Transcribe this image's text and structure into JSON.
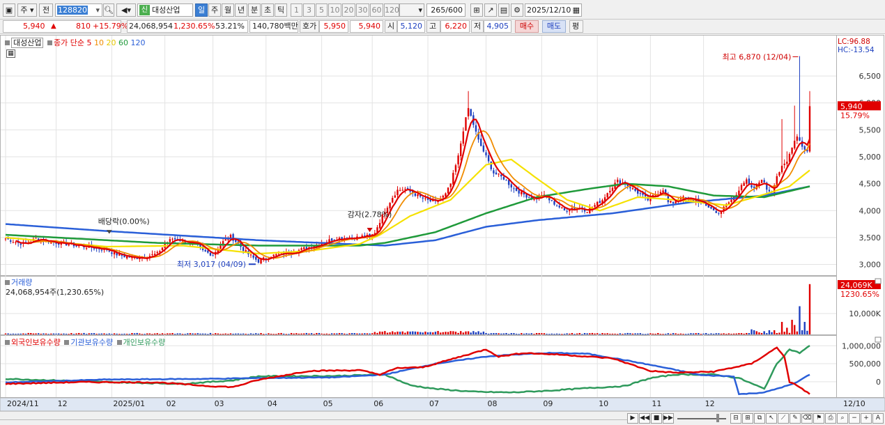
{
  "toolbar": {
    "market": "주",
    "prev": "전",
    "code": "128820",
    "periods": [
      "일",
      "주",
      "월",
      "년",
      "분",
      "초",
      "틱"
    ],
    "active_period": "일",
    "intervals": [
      "1",
      "3",
      "5",
      "10",
      "20",
      "30",
      "60",
      "120"
    ],
    "count": "265",
    "count_max": "/600",
    "date": "2025/12/10",
    "stock_badge": "신",
    "stock_name": "대성산업"
  },
  "info": {
    "price": "5,940",
    "change_arrow": "▲",
    "change": "810",
    "change_pct": "+15.79%",
    "volume": "24,068,954",
    "volume_ratio": "1,230.65%",
    "turnover": "53.21%",
    "amount": "140,780백만",
    "quote_label": "호가",
    "ask": "5,950",
    "bid": "5,940",
    "open_label": "시",
    "open": "5,120",
    "high_label": "고",
    "high": "6,220",
    "low_label": "저",
    "low": "4,905",
    "buy_label": "매수",
    "sell_label": "매도",
    "eval_label": "평"
  },
  "colors": {
    "up": "#e00000",
    "down": "#1d3fbf",
    "ma5": "#e00000",
    "ma10": "#f08c00",
    "ma20": "#f5e100",
    "ma60": "#1f9a3a",
    "ma120": "#2a5fd8",
    "foreign": "#e00000",
    "institution": "#2a5fd8",
    "individual": "#2f9a5c"
  },
  "chart_data": [
    {
      "type": "candlestick",
      "legend_name": "대성산업",
      "legend_items": [
        {
          "label": "종가 단순 5",
          "color": "#e00000"
        },
        {
          "label": "10",
          "color": "#f08c00"
        },
        {
          "label": "20",
          "color": "#e6c800"
        },
        {
          "label": "60",
          "color": "#1f9a3a"
        },
        {
          "label": "120",
          "color": "#2a5fd8"
        }
      ],
      "y_ticks": [
        "6,500",
        "6,000",
        "5,500",
        "5,000",
        "4,500",
        "4,000",
        "3,500",
        "3,000"
      ],
      "ylim": [
        2800,
        7200
      ],
      "lc_label": "LC:96.88",
      "hc_label": "HC:-13.54",
      "last_price_tag": "5,940",
      "last_pct_tag": "15.79%",
      "annotations": {
        "high": "최고 6,870 (12/04)",
        "low": "최저 3,017 (04/09)",
        "dividend": "배당락(0.00%)",
        "capital_reduction": "감자(2.78%)"
      },
      "anchors": [
        [
          0,
          3480
        ],
        [
          5,
          3400
        ],
        [
          8,
          3380
        ],
        [
          12,
          3480
        ],
        [
          18,
          3420
        ],
        [
          24,
          3380
        ],
        [
          30,
          3340
        ],
        [
          36,
          3300
        ],
        [
          40,
          3280
        ],
        [
          43,
          3200
        ],
        [
          47,
          3150
        ],
        [
          51,
          3120
        ],
        [
          55,
          3140
        ],
        [
          60,
          3200
        ],
        [
          63,
          3380
        ],
        [
          66,
          3480
        ],
        [
          69,
          3450
        ],
        [
          72,
          3400
        ],
        [
          75,
          3380
        ],
        [
          78,
          3250
        ],
        [
          82,
          3180
        ],
        [
          86,
          3420
        ],
        [
          89,
          3520
        ],
        [
          92,
          3380
        ],
        [
          95,
          3230
        ],
        [
          98,
          3120
        ],
        [
          100,
          3060
        ],
        [
          102,
          3100
        ],
        [
          105,
          3160
        ],
        [
          110,
          3200
        ],
        [
          115,
          3250
        ],
        [
          120,
          3320
        ],
        [
          125,
          3400
        ],
        [
          130,
          3480
        ],
        [
          135,
          3500
        ],
        [
          140,
          3500
        ],
        [
          142,
          3540
        ],
        [
          144,
          3500
        ],
        [
          146,
          3600
        ],
        [
          148,
          3800
        ],
        [
          150,
          4000
        ],
        [
          153,
          4250
        ],
        [
          155,
          4380
        ],
        [
          158,
          4400
        ],
        [
          162,
          4300
        ],
        [
          166,
          4200
        ],
        [
          170,
          4150
        ],
        [
          174,
          4300
        ],
        [
          176,
          4500
        ],
        [
          179,
          5000
        ],
        [
          181,
          5500
        ],
        [
          183,
          5900
        ],
        [
          185,
          5600
        ],
        [
          187,
          5300
        ],
        [
          190,
          5000
        ],
        [
          193,
          4700
        ],
        [
          197,
          4600
        ],
        [
          201,
          4400
        ],
        [
          205,
          4300
        ],
        [
          209,
          4200
        ],
        [
          212,
          4300
        ],
        [
          215,
          4200
        ],
        [
          218,
          4100
        ],
        [
          221,
          4000
        ],
        [
          224,
          4050
        ],
        [
          227,
          4050
        ],
        [
          230,
          4000
        ],
        [
          233,
          4100
        ],
        [
          236,
          4200
        ],
        [
          239,
          4400
        ],
        [
          242,
          4550
        ],
        [
          245,
          4500
        ],
        [
          248,
          4400
        ],
        [
          251,
          4300
        ],
        [
          254,
          4200
        ],
        [
          257,
          4300
        ],
        [
          260,
          4400
        ],
        [
          262,
          4150
        ],
        [
          264,
          4150
        ],
        [
          267,
          4250
        ],
        [
          270,
          4200
        ],
        [
          273,
          4200
        ],
        [
          276,
          4100
        ],
        [
          279,
          4050
        ],
        [
          281,
          3950
        ],
        [
          283,
          4000
        ],
        [
          285,
          4100
        ],
        [
          287,
          4200
        ],
        [
          289,
          4300
        ],
        [
          291,
          4500
        ],
        [
          293,
          4550
        ],
        [
          295,
          4400
        ],
        [
          297,
          4450
        ],
        [
          299,
          4600
        ],
        [
          301,
          4400
        ],
        [
          303,
          4350
        ],
        [
          305,
          4650
        ],
        [
          307,
          4800
        ],
        [
          309,
          4900
        ],
        [
          311,
          5200
        ],
        [
          313,
          5400
        ],
        [
          315,
          5200
        ],
        [
          317,
          5100
        ],
        [
          318,
          5940
        ]
      ],
      "spikes": {
        "183": 6220,
        "307": 5700,
        "309": 5100,
        "312": 5950,
        "314": 6870,
        "318": 6220
      },
      "ma": {
        "ma20": [
          [
            0,
            3500
          ],
          [
            40,
            3330
          ],
          [
            70,
            3350
          ],
          [
            100,
            3200
          ],
          [
            120,
            3250
          ],
          [
            140,
            3380
          ],
          [
            148,
            3550
          ],
          [
            160,
            3900
          ],
          [
            176,
            4200
          ],
          [
            190,
            4850
          ],
          [
            200,
            4950
          ],
          [
            210,
            4600
          ],
          [
            222,
            4200
          ],
          [
            235,
            4000
          ],
          [
            250,
            4250
          ],
          [
            265,
            4200
          ],
          [
            285,
            4100
          ],
          [
            300,
            4300
          ],
          [
            310,
            4450
          ],
          [
            318,
            4750
          ]
        ],
        "ma60": [
          [
            0,
            3550
          ],
          [
            60,
            3400
          ],
          [
            100,
            3350
          ],
          [
            140,
            3350
          ],
          [
            150,
            3400
          ],
          [
            170,
            3600
          ],
          [
            190,
            3950
          ],
          [
            210,
            4250
          ],
          [
            230,
            4400
          ],
          [
            245,
            4500
          ],
          [
            262,
            4450
          ],
          [
            280,
            4280
          ],
          [
            300,
            4250
          ],
          [
            318,
            4450
          ]
        ],
        "ma120": [
          [
            0,
            3750
          ],
          [
            40,
            3620
          ],
          [
            100,
            3450
          ],
          [
            150,
            3350
          ],
          [
            170,
            3450
          ],
          [
            190,
            3700
          ],
          [
            210,
            3820
          ],
          [
            240,
            3950
          ],
          [
            270,
            4150
          ],
          [
            300,
            4280
          ],
          [
            318,
            4450
          ]
        ]
      }
    },
    {
      "type": "bar",
      "title": "거래량",
      "summary": "24,068,954주(1,230.65%)",
      "y_ticks": [
        "10,000K"
      ],
      "last_tag": "24,069K",
      "last_pct_tag": "1230.65%",
      "ylim": [
        0,
        26000
      ]
    },
    {
      "type": "line",
      "series": [
        {
          "name": "외국인보유수량"
        },
        {
          "name": "기관보유수량"
        },
        {
          "name": "개인보유수량"
        }
      ],
      "y_ticks": [
        "1,000,000",
        "500,000",
        "0"
      ],
      "ylim": [
        -430000,
        1180000
      ],
      "foreign": [
        [
          0,
          -60000
        ],
        [
          30,
          -10000
        ],
        [
          60,
          -20000
        ],
        [
          80,
          -120000
        ],
        [
          90,
          -150000
        ],
        [
          100,
          50000
        ],
        [
          120,
          300000
        ],
        [
          140,
          320000
        ],
        [
          148,
          200000
        ],
        [
          155,
          380000
        ],
        [
          165,
          400000
        ],
        [
          180,
          700000
        ],
        [
          190,
          900000
        ],
        [
          195,
          700000
        ],
        [
          205,
          800000
        ],
        [
          220,
          750000
        ],
        [
          240,
          650000
        ],
        [
          255,
          300000
        ],
        [
          265,
          250000
        ],
        [
          280,
          280000
        ],
        [
          295,
          500000
        ],
        [
          305,
          950000
        ],
        [
          308,
          700000
        ],
        [
          310,
          -20000
        ],
        [
          313,
          -100000
        ],
        [
          318,
          -350000
        ]
      ],
      "institution": [
        [
          0,
          -20000
        ],
        [
          40,
          60000
        ],
        [
          80,
          80000
        ],
        [
          100,
          100000
        ],
        [
          130,
          120000
        ],
        [
          150,
          200000
        ],
        [
          170,
          500000
        ],
        [
          180,
          600000
        ],
        [
          190,
          700000
        ],
        [
          200,
          750000
        ],
        [
          215,
          800000
        ],
        [
          230,
          780000
        ],
        [
          245,
          600000
        ],
        [
          260,
          400000
        ],
        [
          275,
          180000
        ],
        [
          288,
          150000
        ],
        [
          290,
          -350000
        ],
        [
          300,
          -300000
        ],
        [
          312,
          -50000
        ],
        [
          318,
          200000
        ]
      ],
      "individual": [
        [
          0,
          80000
        ],
        [
          40,
          -10000
        ],
        [
          70,
          -60000
        ],
        [
          90,
          40000
        ],
        [
          100,
          150000
        ],
        [
          130,
          160000
        ],
        [
          150,
          200000
        ],
        [
          160,
          -100000
        ],
        [
          170,
          -200000
        ],
        [
          185,
          -280000
        ],
        [
          200,
          -300000
        ],
        [
          215,
          -250000
        ],
        [
          230,
          -180000
        ],
        [
          245,
          -120000
        ],
        [
          255,
          100000
        ],
        [
          265,
          200000
        ],
        [
          280,
          200000
        ],
        [
          290,
          100000
        ],
        [
          300,
          -200000
        ],
        [
          305,
          500000
        ],
        [
          310,
          900000
        ],
        [
          314,
          800000
        ],
        [
          318,
          1000000
        ]
      ],
      "x_labels": [
        {
          "label": "2024/11",
          "idx": 0
        },
        {
          "label": "12",
          "idx": 20
        },
        {
          "label": "2025/01",
          "idx": 42
        },
        {
          "label": "02",
          "idx": 63
        },
        {
          "label": "03",
          "idx": 82
        },
        {
          "label": "04",
          "idx": 103
        },
        {
          "label": "05",
          "idx": 125
        },
        {
          "label": "06",
          "idx": 145
        },
        {
          "label": "07",
          "idx": 167
        },
        {
          "label": "08",
          "idx": 190
        },
        {
          "label": "09",
          "idx": 212
        },
        {
          "label": "10",
          "idx": 234
        },
        {
          "label": "11",
          "idx": 255
        },
        {
          "label": "12",
          "idx": 276
        },
        {
          "label": "12/10",
          "idx": 294
        }
      ]
    }
  ]
}
